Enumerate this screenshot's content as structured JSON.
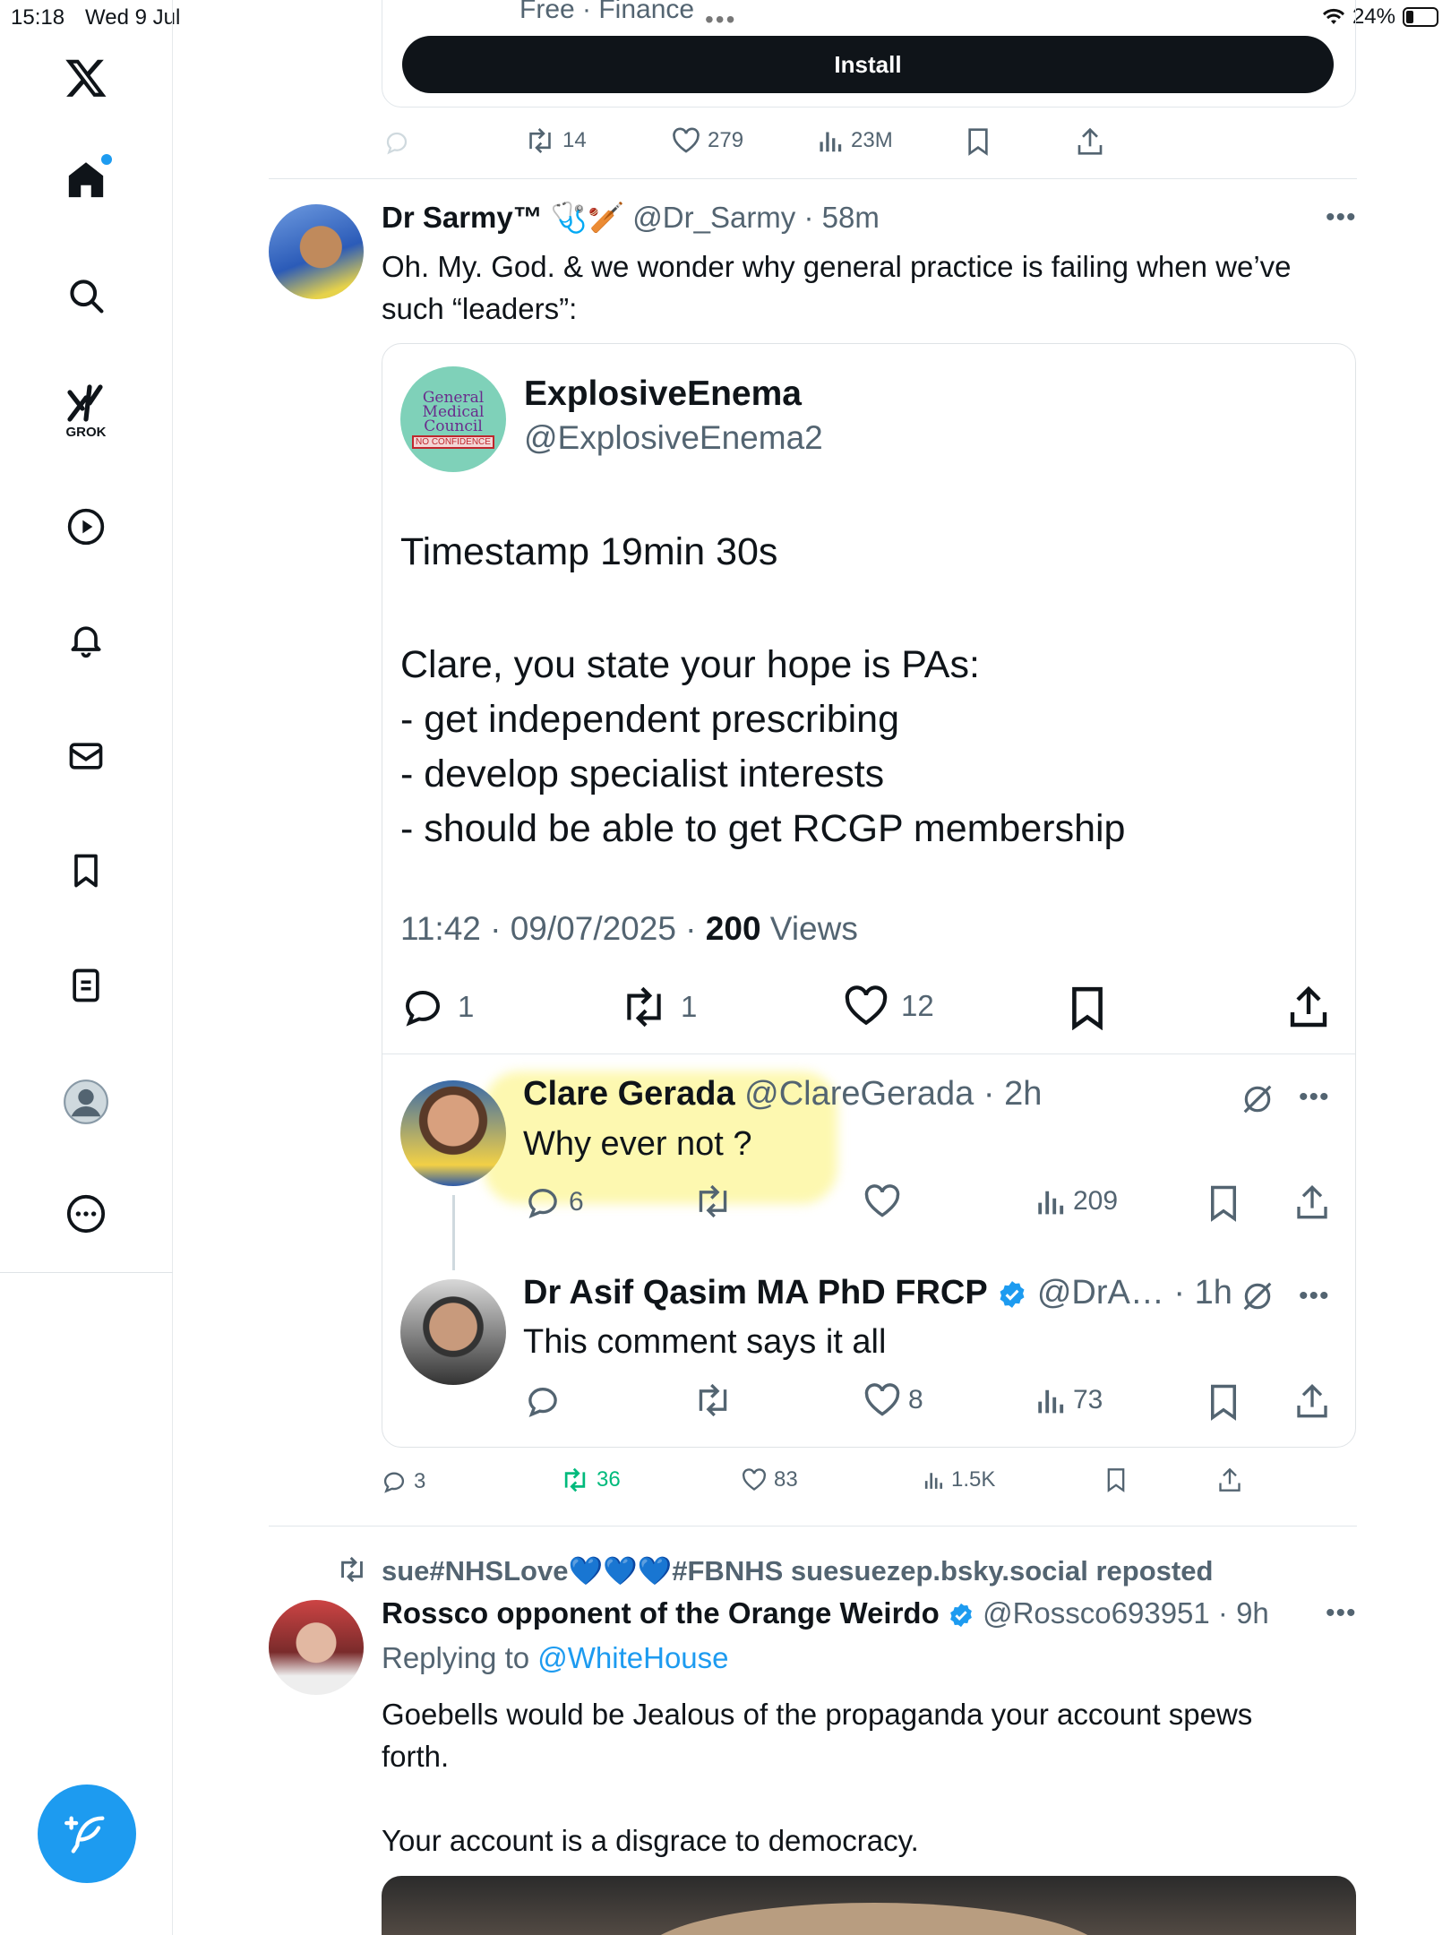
{
  "status_bar": {
    "time": "15:18",
    "date": "Wed 9 Jul",
    "battery": "24%"
  },
  "ad": {
    "subtitle": "Free · Finance",
    "install_label": "Install",
    "retweets": "14",
    "likes": "279",
    "views": "23M"
  },
  "post": {
    "name": "Dr Sarmy™",
    "name_emoji": "🩺🏏",
    "handle": "@Dr_Sarmy",
    "time": "58m",
    "text_line1": "Oh. My. God. & we wonder why general practice is failing when we’ve",
    "text_line2": "such “leaders”:",
    "replies": "3",
    "retweets": "36",
    "likes": "83",
    "views": "1.5K",
    "quote": {
      "name": "ExplosiveEnema",
      "handle": "@ExplosiveEnema2",
      "avatar_text": "General Medical Council",
      "avatar_stamp": "NO CONFIDENCE",
      "line1": "Timestamp 19min 30s",
      "line2": "Clare, you state your hope is PAs:",
      "line3": "- get independent prescribing",
      "line4": "- develop specialist interests",
      "line5": "- should be able to get RCGP membership",
      "meta_time": "11:42 · 09/07/2025 · ",
      "meta_views_num": "200",
      "meta_views_label": " Views",
      "replies": "1",
      "retweets": "1",
      "likes": "12"
    },
    "reply1": {
      "name": "Clare Gerada",
      "handle": "@ClareGerada",
      "time": "2h",
      "text": "Why ever not ?",
      "replies": "6",
      "views": "209"
    },
    "reply2": {
      "name": "Dr Asif Qasim MA PhD FRCP",
      "handle": "@DrA…",
      "time": "1h",
      "text": "This comment says it all",
      "likes": "8",
      "views": "73"
    }
  },
  "post2": {
    "repost_by": "sue#NHSLove💙💙💙#FBNHS suesuezep.bsky.social reposted",
    "name": "Rossco opponent of the Orange Weirdo",
    "handle": "@Rossco693951",
    "time": "9h",
    "replying_prefix": "Replying to ",
    "replying_to": "@WhiteHouse",
    "text_line1": "Goebells would be Jealous of the propaganda your account spews",
    "text_line2": "forth.",
    "text_line3": "Your account is a disgrace to democracy."
  },
  "nav": {
    "grok_label": "GROK"
  },
  "colors": {
    "accent": "#1d9bf0",
    "retweet_green": "#00ba7c",
    "text": "#0f1419",
    "muted": "#536471"
  }
}
